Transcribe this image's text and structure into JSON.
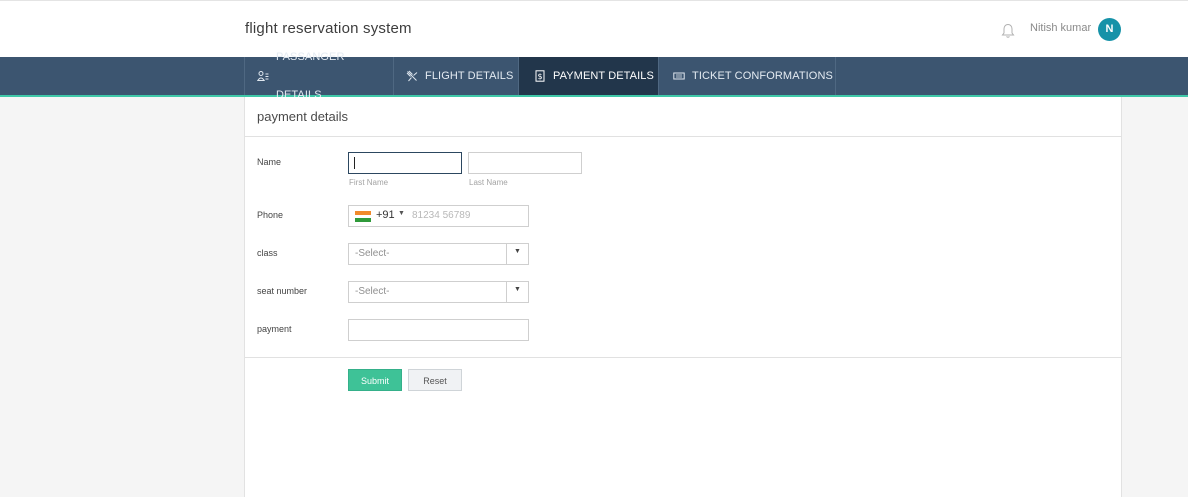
{
  "header": {
    "app_title": "flight reservation system",
    "user_name": "Nitish kumar",
    "avatar_initial": "N"
  },
  "tabs": [
    {
      "label": "PASSANGER DETAILS",
      "icon": "passenger-icon",
      "active": false
    },
    {
      "label": "FLIGHT DETAILS",
      "icon": "flight-icon",
      "active": false
    },
    {
      "label": "PAYMENT DETAILS",
      "icon": "payment-icon",
      "active": true
    },
    {
      "label": "TICKET CONFORMATIONS",
      "icon": "ticket-icon",
      "active": false
    }
  ],
  "form": {
    "title": "payment details",
    "name_label": "Name",
    "first_name_value": "",
    "first_name_hint": "First Name",
    "last_name_value": "",
    "last_name_hint": "Last Name",
    "phone_label": "Phone",
    "phone_country_code": "+91",
    "phone_placeholder": "81234 56789",
    "class_label": "class",
    "class_selected": "-Select-",
    "seat_label": "seat number",
    "seat_selected": "-Select-",
    "payment_label": "payment",
    "payment_value": "",
    "submit_label": "Submit",
    "reset_label": "Reset"
  },
  "colors": {
    "navbar": "#3c5570",
    "active_tab": "#22364b",
    "accent_line": "#3fc8a8",
    "avatar": "#1692a8",
    "submit": "#3ec297"
  }
}
